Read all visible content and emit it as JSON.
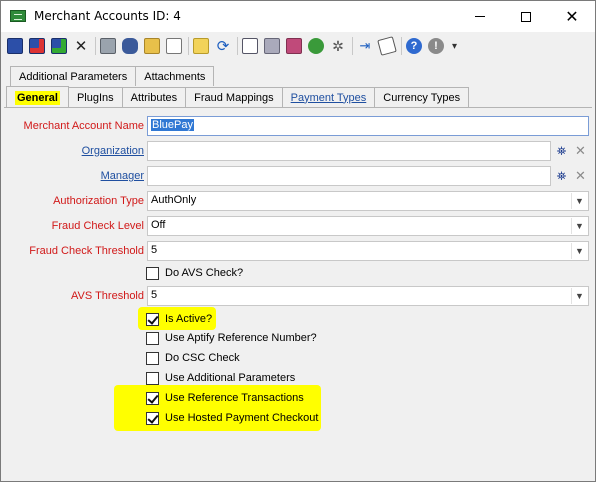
{
  "window": {
    "title": "Merchant Accounts ID: 4"
  },
  "toolbar": {
    "icons": [
      "save-icon",
      "save-close-icon",
      "save-new-icon",
      "delete-icon",
      "print-icon",
      "find-icon",
      "open-icon",
      "report-icon",
      "wizard-icon",
      "refresh-icon",
      "link-icon",
      "copy-icon",
      "related-icon",
      "web-icon",
      "settings-icon",
      "import-icon",
      "notes-icon",
      "help-icon",
      "info-icon"
    ]
  },
  "tabs": {
    "row1": [
      "Additional Parameters",
      "Attachments"
    ],
    "row2": [
      "General",
      "PlugIns",
      "Attributes",
      "Fraud Mappings",
      "Payment Types",
      "Currency Types"
    ],
    "active": "General"
  },
  "form": {
    "merchant_account_name": {
      "label": "Merchant Account Name",
      "value": "BluePay"
    },
    "organization": {
      "label": "Organization",
      "value": ""
    },
    "manager": {
      "label": "Manager",
      "value": ""
    },
    "authorization_type": {
      "label": "Authorization Type",
      "value": "AuthOnly"
    },
    "fraud_check_level": {
      "label": "Fraud Check Level",
      "value": "Off"
    },
    "fraud_check_threshold": {
      "label": "Fraud Check Threshold",
      "value": "5"
    },
    "do_avs_check": {
      "label": "Do AVS Check?",
      "checked": false
    },
    "avs_threshold": {
      "label": "AVS Threshold",
      "value": "5"
    },
    "is_active": {
      "label": "Is Active?",
      "checked": true
    },
    "use_aptify_reference_number": {
      "label": "Use Aptify Reference Number?",
      "checked": false
    },
    "do_csc_check": {
      "label": "Do CSC Check",
      "checked": false
    },
    "use_additional_parameters": {
      "label": "Use Additional Parameters",
      "checked": false
    },
    "use_reference_transactions": {
      "label": "Use Reference Transactions",
      "checked": true
    },
    "use_hosted_payment_checkout": {
      "label": "Use Hosted Payment Checkout",
      "checked": true
    }
  },
  "colors": {
    "required_label": "#d11919",
    "link_label": "#1f4fa0",
    "highlight": "#ffff00"
  }
}
